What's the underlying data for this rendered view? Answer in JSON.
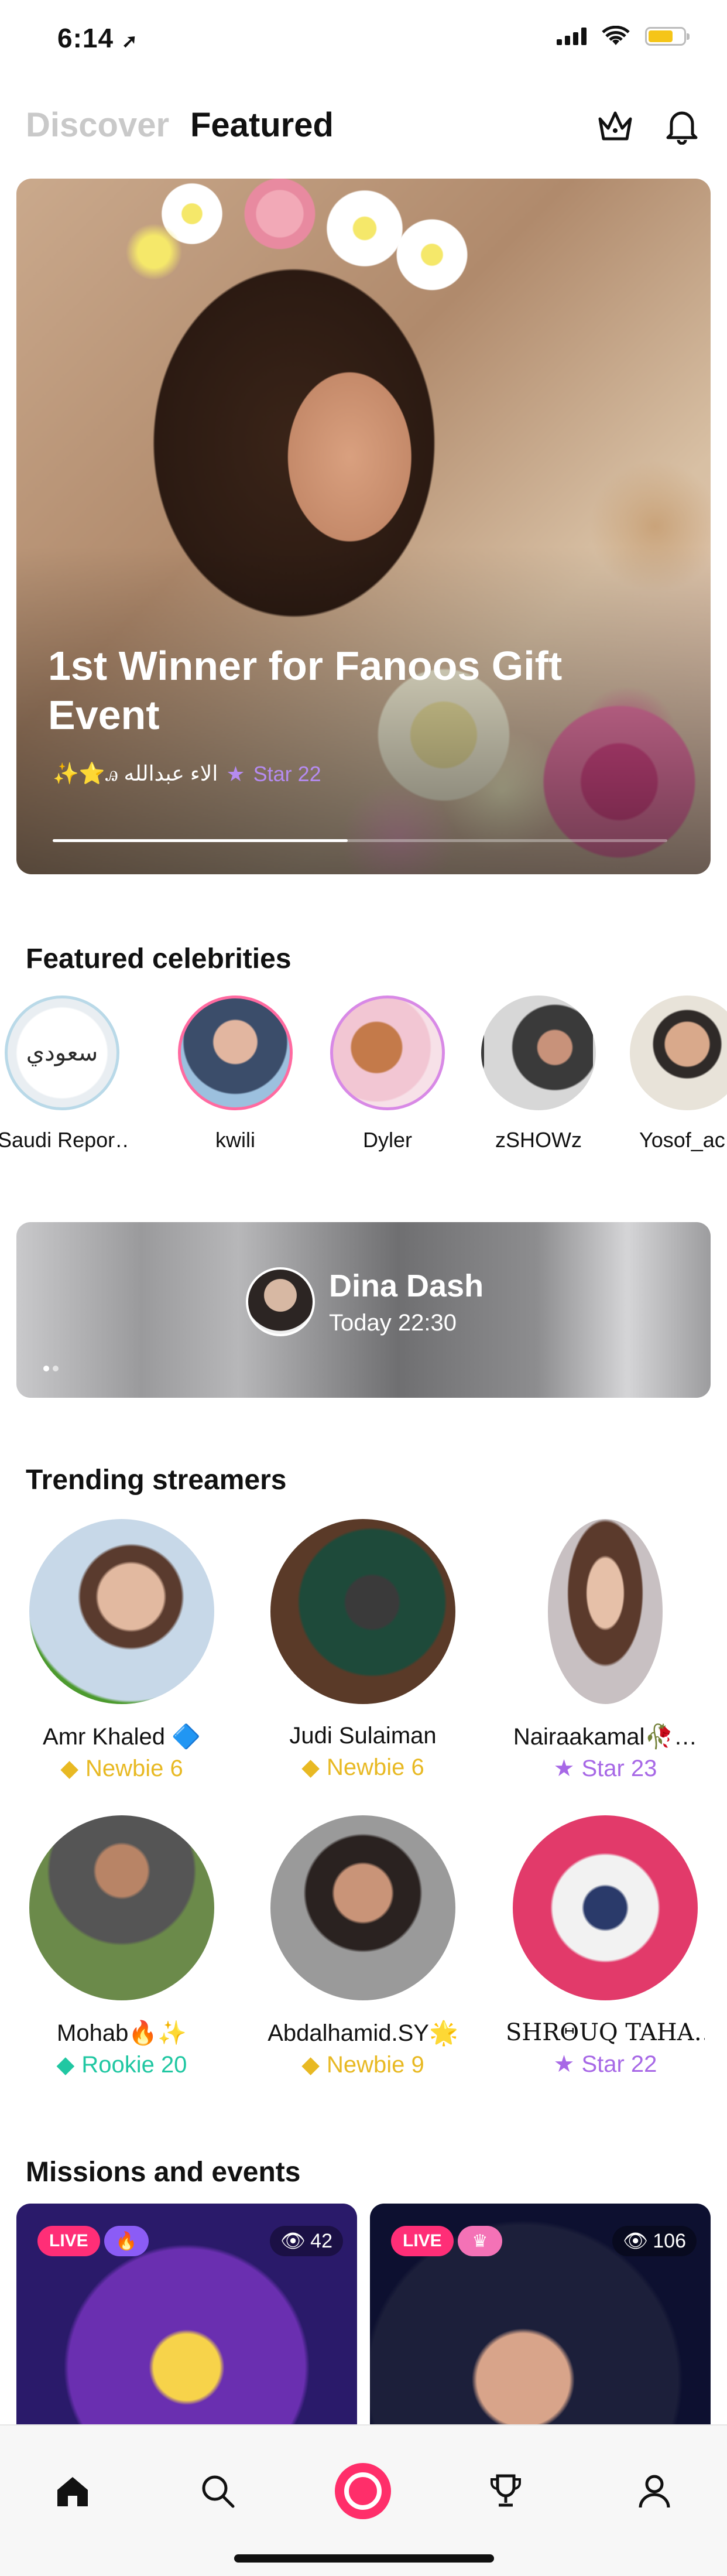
{
  "status_bar": {
    "time": "6:14"
  },
  "header": {
    "tab_discover": "Discover",
    "tab_featured": "Featured",
    "crown_icon": "crown-icon",
    "bell_icon": "bell-icon"
  },
  "hero": {
    "title": "1st Winner for Fanoos Gift Event",
    "host_name": "✨⭐ꭿ الاء عبدالله",
    "host_level": "Star 22",
    "progress": 0.48
  },
  "celebrities": {
    "title": "Featured celebrities",
    "items": [
      {
        "name": "Saudi Repor…"
      },
      {
        "name": "kwili"
      },
      {
        "name": "Dyler"
      },
      {
        "name": "zSHOWz"
      },
      {
        "name": "Yosof_ac"
      }
    ]
  },
  "live_banner": {
    "name": "Dina Dash",
    "time": "Today 22:30"
  },
  "trending": {
    "title": "Trending streamers",
    "items": [
      {
        "name": "Amr Khaled  🔷",
        "level": "Newbie 6",
        "tier": "newbie"
      },
      {
        "name": "Judi Sulaiman",
        "level": "Newbie 6",
        "tier": "newbie"
      },
      {
        "name": "Nairaakamal🥀…",
        "level": "Star 23",
        "tier": "star"
      },
      {
        "name": "Mohab🔥✨",
        "level": "Rookie 20",
        "tier": "rookie"
      },
      {
        "name": "Abdalhamid.SY🌟",
        "level": "Newbie 9",
        "tier": "newbie"
      },
      {
        "name": "SHRΘUQ TAHA…",
        "level": "Star 22",
        "tier": "star"
      }
    ]
  },
  "missions": {
    "title": "Missions and events",
    "cards": [
      {
        "badge": "LIVE",
        "viewers": "42"
      },
      {
        "badge": "LIVE",
        "viewers": "106"
      }
    ]
  },
  "nav": {
    "items": [
      "home-icon",
      "search-icon",
      "go-live-icon",
      "trophy-icon",
      "profile-icon"
    ]
  }
}
